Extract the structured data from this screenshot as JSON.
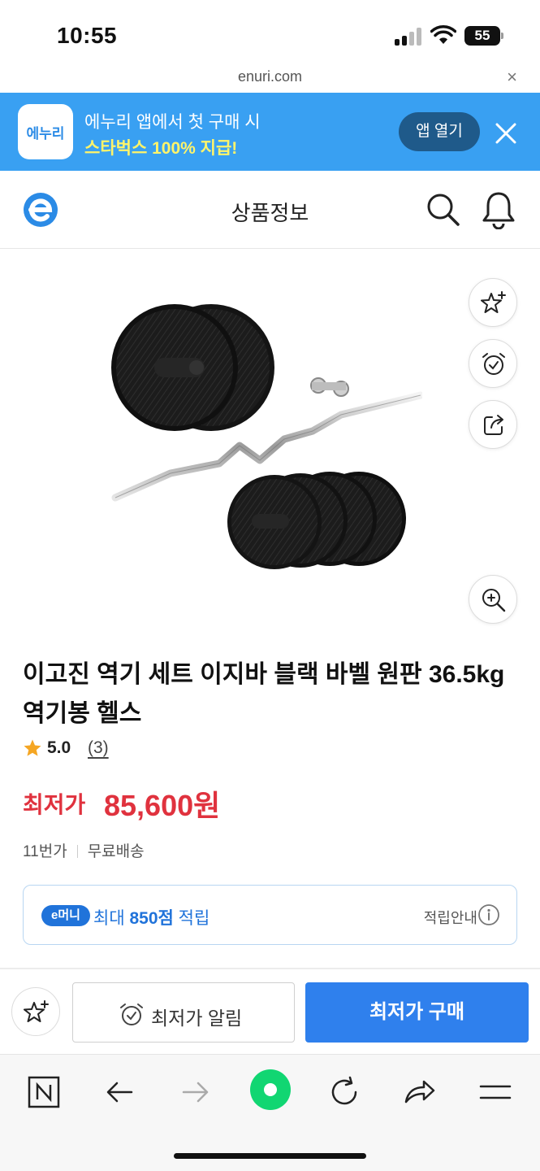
{
  "status_bar": {
    "time": "10:55",
    "battery": "55"
  },
  "browser": {
    "url": "enuri.com",
    "close_symbol": "×"
  },
  "app_banner": {
    "logo_text": "에누리",
    "line1": "에누리 앱에서 첫 구매 시",
    "line2": "스타벅스 100% 지급!",
    "open_button": "앱 열기",
    "close_icon": "close-icon"
  },
  "header": {
    "title": "상품정보",
    "icons": [
      "enuri-logo-icon",
      "search-icon",
      "bell-icon"
    ]
  },
  "side_actions": [
    "favorite-star-icon",
    "alarm-clock-icon",
    "share-icon",
    "zoom-in-icon"
  ],
  "product": {
    "title": "이고진 역기 세트 이지바 블랙 바벨 원판 36.5kg 역기봉 헬스",
    "rating": "5.0",
    "review_count": "(3)",
    "price_label": "최저가",
    "price": "85,600원",
    "shop": "11번가",
    "shipping": "무료배송"
  },
  "point": {
    "badge": "e머니",
    "text_prefix": "최대 ",
    "amount": "850점",
    "text_suffix": " 적립",
    "info_label": "적립안내"
  },
  "action_bar": {
    "alert_label": "최저가 알림",
    "buy_label": "최저가 구매"
  },
  "colors": {
    "banner_bg": "#39a0f2",
    "banner_highlight": "#fff46a",
    "price_red": "#e0323e",
    "point_blue": "#2073da",
    "buy_blue": "#2f80ed",
    "toolbar_green": "#11d672"
  },
  "browser_toolbar": [
    "naver-n-icon",
    "back-arrow-icon",
    "forward-arrow-icon",
    "green-home-icon",
    "reload-icon",
    "share-arrow-icon",
    "menu-icon"
  ]
}
